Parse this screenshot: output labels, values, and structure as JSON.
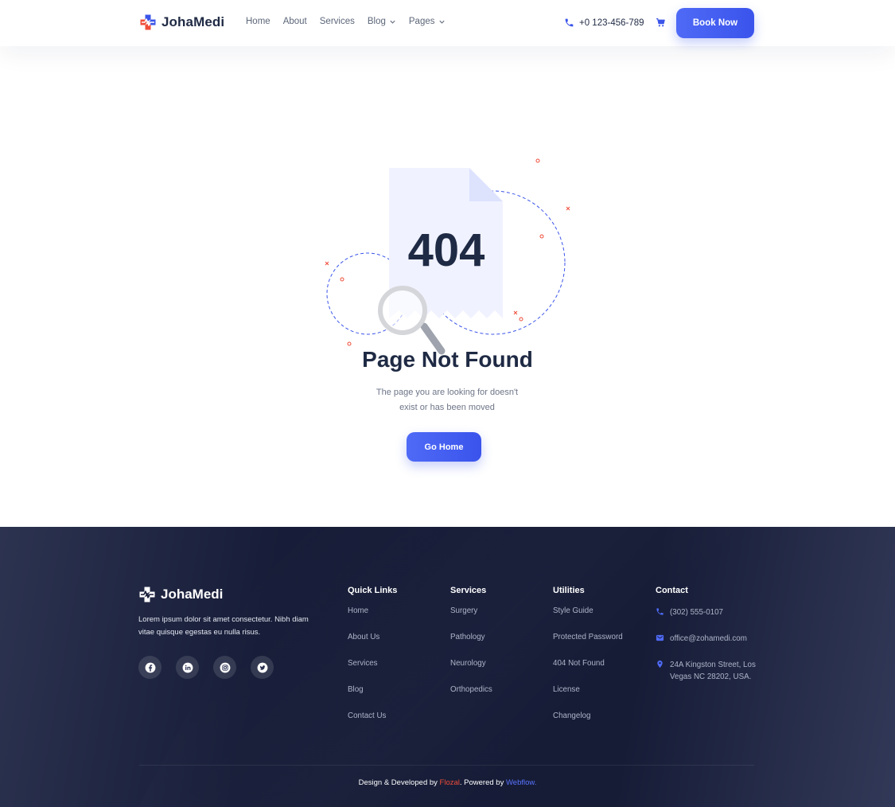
{
  "brand": {
    "name": "JohaMedi"
  },
  "nav": {
    "items": [
      {
        "label": "Home"
      },
      {
        "label": "About"
      },
      {
        "label": "Services"
      },
      {
        "label": "Blog"
      },
      {
        "label": "Pages"
      }
    ]
  },
  "header": {
    "phone": "+0 123-456-789",
    "cta": "Book Now"
  },
  "error": {
    "code": "404",
    "title": "Page Not Found",
    "description": "The page you are looking for doesn't exist or has been moved",
    "button": "Go Home"
  },
  "footer": {
    "brand": "JohaMedi",
    "about": "Lorem ipsum dolor sit amet consectetur. Nibh diam vitae quisque egestas eu nulla risus.",
    "socials": [
      "facebook-icon",
      "linkedin-icon",
      "instagram-icon",
      "twitter-icon"
    ],
    "columns": [
      {
        "title": "Quick Links",
        "links": [
          "Home",
          "About Us",
          "Services",
          "Blog",
          "Contact Us"
        ]
      },
      {
        "title": "Services",
        "links": [
          "Surgery",
          "Pathology",
          "Neurology",
          "Orthopedics"
        ]
      },
      {
        "title": "Utilities",
        "links": [
          "Style Guide",
          "Protected Password",
          "404 Not Found",
          "License",
          "Changelog"
        ]
      }
    ],
    "contact": {
      "title": "Contact",
      "phone": "(302) 555-0107",
      "email": "office@zohamedi.com",
      "address": "24A Kingston Street, Los Vegas NC 28202, USA."
    },
    "copyright": {
      "prefix": "Design & Developed by ",
      "author": "Flozal",
      "middle": ". Powered by ",
      "platform": "Webflow."
    }
  },
  "colors": {
    "accent": "#4f6af6",
    "logo_red": "#ef4d3a",
    "dark": "#1f2a44",
    "footer_bg": "#171d38"
  }
}
